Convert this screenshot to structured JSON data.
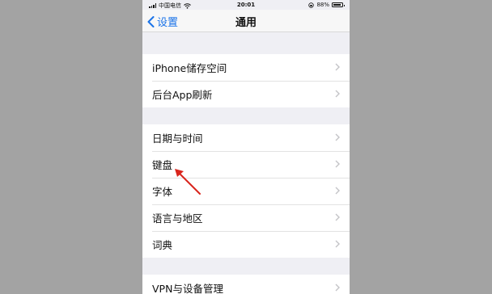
{
  "status_bar": {
    "carrier": "中国电信",
    "time": "20:01",
    "battery_percent": "88%",
    "battery_level": 0.88,
    "icons": [
      "signal-icon",
      "wifi-icon",
      "lock-rotation-icon",
      "battery-icon"
    ]
  },
  "nav": {
    "back_label": "设置",
    "title": "通用"
  },
  "groups": [
    {
      "rows": [
        {
          "label": "iPhone储存空间"
        },
        {
          "label": "后台App刷新"
        }
      ]
    },
    {
      "rows": [
        {
          "label": "日期与时间"
        },
        {
          "label": "键盘"
        },
        {
          "label": "字体"
        },
        {
          "label": "语言与地区"
        },
        {
          "label": "词典"
        }
      ]
    },
    {
      "rows": [
        {
          "label": "VPN与设备管理"
        }
      ]
    }
  ],
  "colors": {
    "accent": "#1a73e8",
    "annotation": "#d9251d",
    "grouped_background": "#efeff4"
  }
}
